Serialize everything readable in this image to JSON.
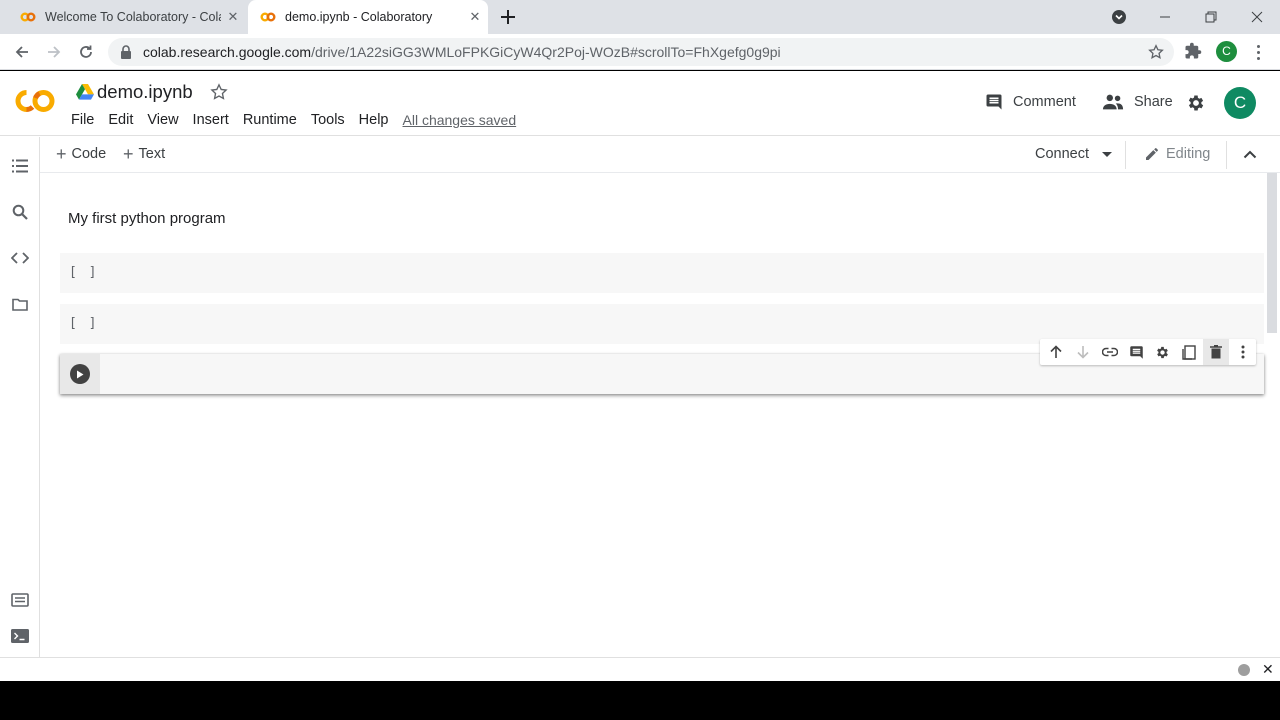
{
  "browser": {
    "tabs": [
      {
        "title": "Welcome To Colaboratory - Colab",
        "active": false
      },
      {
        "title": "demo.ipynb - Colaboratory",
        "active": true
      }
    ],
    "url_host": "colab.research.google.com",
    "url_path": "/drive/1A22siGG3WMLoFPKGiCyW4Qr2Poj-WOzB#scrollTo=FhXgefg0g9pi",
    "profile_initial": "C"
  },
  "colab": {
    "notebook_title": "demo.ipynb",
    "menu": [
      "File",
      "Edit",
      "View",
      "Insert",
      "Runtime",
      "Tools",
      "Help"
    ],
    "save_status": "All changes saved",
    "comment_label": "Comment",
    "share_label": "Share",
    "avatar_initial": "C",
    "toolbar": {
      "add_code": "Code",
      "add_text": "Text",
      "connect": "Connect",
      "editing": "Editing"
    },
    "cells": [
      {
        "type": "text",
        "content": "My first python program"
      },
      {
        "type": "code",
        "exec_label": "[ ]"
      },
      {
        "type": "code",
        "exec_label": "[ ]"
      },
      {
        "type": "code",
        "selected": true
      }
    ]
  },
  "icons": {
    "rail": [
      "table-of-contents-icon",
      "search-icon",
      "code-snippets-icon",
      "files-icon",
      "command-palette-icon",
      "terminal-icon"
    ],
    "cell_toolbar": [
      "move-up-icon",
      "move-down-icon",
      "link-icon",
      "comment-icon",
      "settings-icon",
      "mirror-cell-icon",
      "delete-icon",
      "more-icon"
    ]
  },
  "colors": {
    "colab_orange": "#f9ab00",
    "avatar_green": "#0f8a62",
    "profile_green": "#1e8e3e"
  }
}
